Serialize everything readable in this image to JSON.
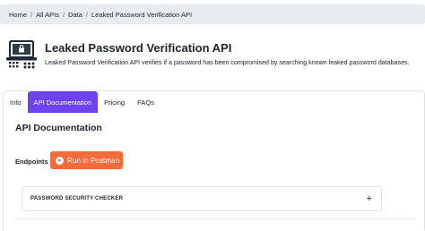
{
  "breadcrumb": {
    "items": [
      "Home",
      "All APIs",
      "Data",
      "Leaked Password Verification API"
    ],
    "separator": "/"
  },
  "header": {
    "logo_icon": "laptop-lock-icon",
    "title": "Leaked Password Verification API",
    "description": "Leaked Password Verification API verifies if a password has been compromised by searching known leaked password databases."
  },
  "tabs": [
    {
      "label": "Info",
      "active": false
    },
    {
      "label": "API Documentation",
      "active": true
    },
    {
      "label": "Pricing",
      "active": false
    },
    {
      "label": "FAQs",
      "active": false
    }
  ],
  "docs": {
    "section_title": "API Documentation",
    "endpoints_label": "Endpoints",
    "postman_button_label": "Run in Postman",
    "accordion_label": "PASSWORD SECURITY CHECKER",
    "accordion_icon": "plus-icon"
  },
  "colors": {
    "accent": "#6f42f0",
    "postman": "#f26b3a",
    "breadcrumb_bg": "#e9ecef"
  }
}
